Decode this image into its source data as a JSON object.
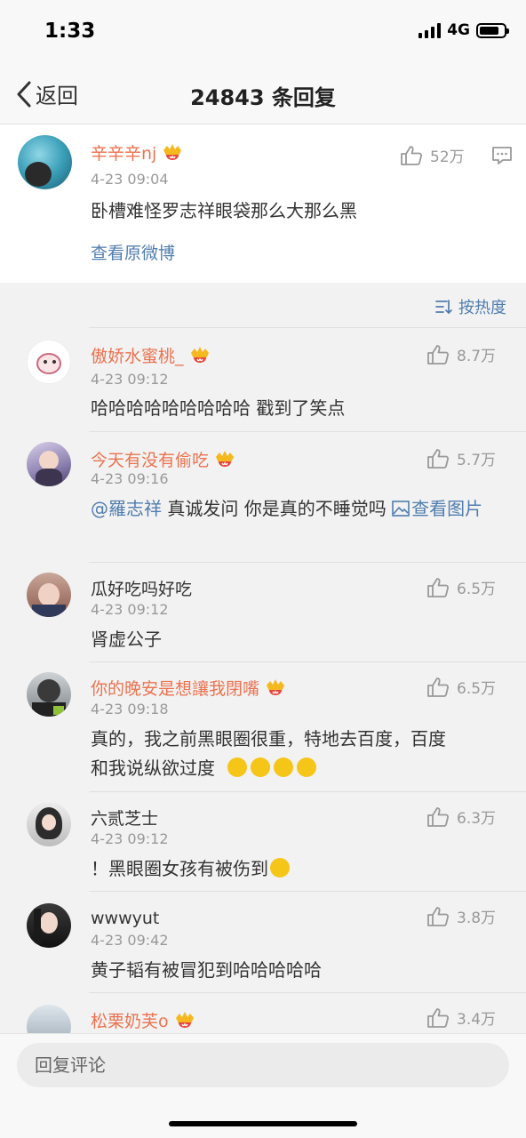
{
  "status": {
    "time": "1:33",
    "network": "4G"
  },
  "nav": {
    "back_label": "返回",
    "title": "24843 条回复"
  },
  "post": {
    "username": "辛辛辛nj",
    "timestamp": "4-23 09:04",
    "likes": "52万",
    "text": "卧槽难怪罗志祥眼袋那么大那么黑",
    "view_original": "查看原微博"
  },
  "sort_label": "按热度",
  "comments": [
    {
      "username": "傲娇水蜜桃_",
      "vip": true,
      "timestamp": "4-23 09:12",
      "likes": "8.7万",
      "text": "哈哈哈哈哈哈哈哈哈 戳到了笑点"
    },
    {
      "username": "今天有没有偷吃",
      "vip": true,
      "timestamp": "4-23 09:16",
      "likes": "5.7万",
      "mention": "@羅志祥",
      "text": " 真诚发问 你是真的不睡觉吗 ",
      "pic_link": "查看图片"
    },
    {
      "username": "瓜好吃吗好吃",
      "vip": false,
      "timestamp": "4-23 09:12",
      "likes": "6.5万",
      "text": "肾虚公子"
    },
    {
      "username": "你的晚安是想讓我閉嘴",
      "vip": true,
      "timestamp": "4-23 09:18",
      "likes": "6.5万",
      "text_line1": "真的，我之前黑眼圈很重，特地去百度，百度",
      "text_line2": "和我说纵欲过度"
    },
    {
      "username": "六贰芝士",
      "vip": false,
      "timestamp": "4-23 09:12",
      "likes": "6.3万",
      "text": "！黑眼圈女孩有被伤到"
    },
    {
      "username": "wwwyut",
      "vip": false,
      "timestamp": "4-23 09:42",
      "likes": "3.8万",
      "text": "黄子韬有被冒犯到哈哈哈哈哈"
    },
    {
      "username": "松栗奶芙o",
      "vip": true,
      "timestamp": "",
      "likes": "3.4万",
      "text": ""
    }
  ],
  "reply_placeholder": "回复评论",
  "colors": {
    "username_vip": "#eb7350",
    "link": "#507daf",
    "muted": "#999999"
  }
}
